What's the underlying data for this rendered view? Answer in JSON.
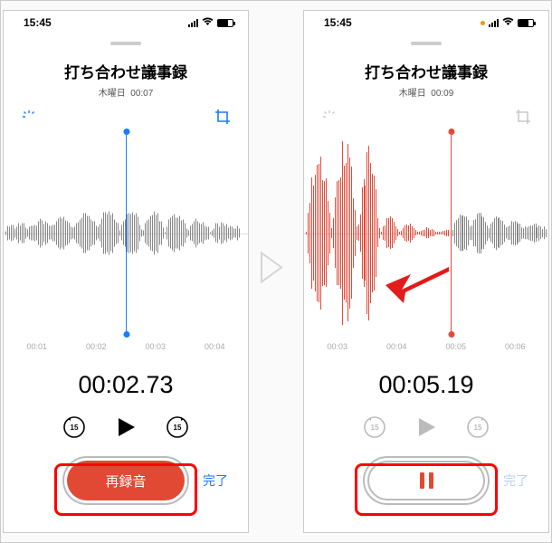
{
  "left": {
    "status_time": "15:45",
    "title": "打ち合わせ議事録",
    "subtitle_day": "木曜日",
    "subtitle_dur": "00:07",
    "ruler": [
      "00:01",
      "00:02",
      "00:03",
      "00:04"
    ],
    "timer": "00:02.73",
    "record_label": "再録音",
    "done_label": "完了",
    "playhead_pct": 50,
    "icon_color": "#187cff"
  },
  "right": {
    "status_time": "15:45",
    "title": "打ち合わせ議事録",
    "subtitle_day": "木曜日",
    "subtitle_dur": "00:09",
    "ruler": [
      "00:03",
      "00:04",
      "00:05",
      "00:06"
    ],
    "timer": "00:05.19",
    "done_label": "完了",
    "playhead_pct": 60,
    "icon_color": "#c9c9c9",
    "has_orange_dot": true
  },
  "skip_seconds": "15"
}
